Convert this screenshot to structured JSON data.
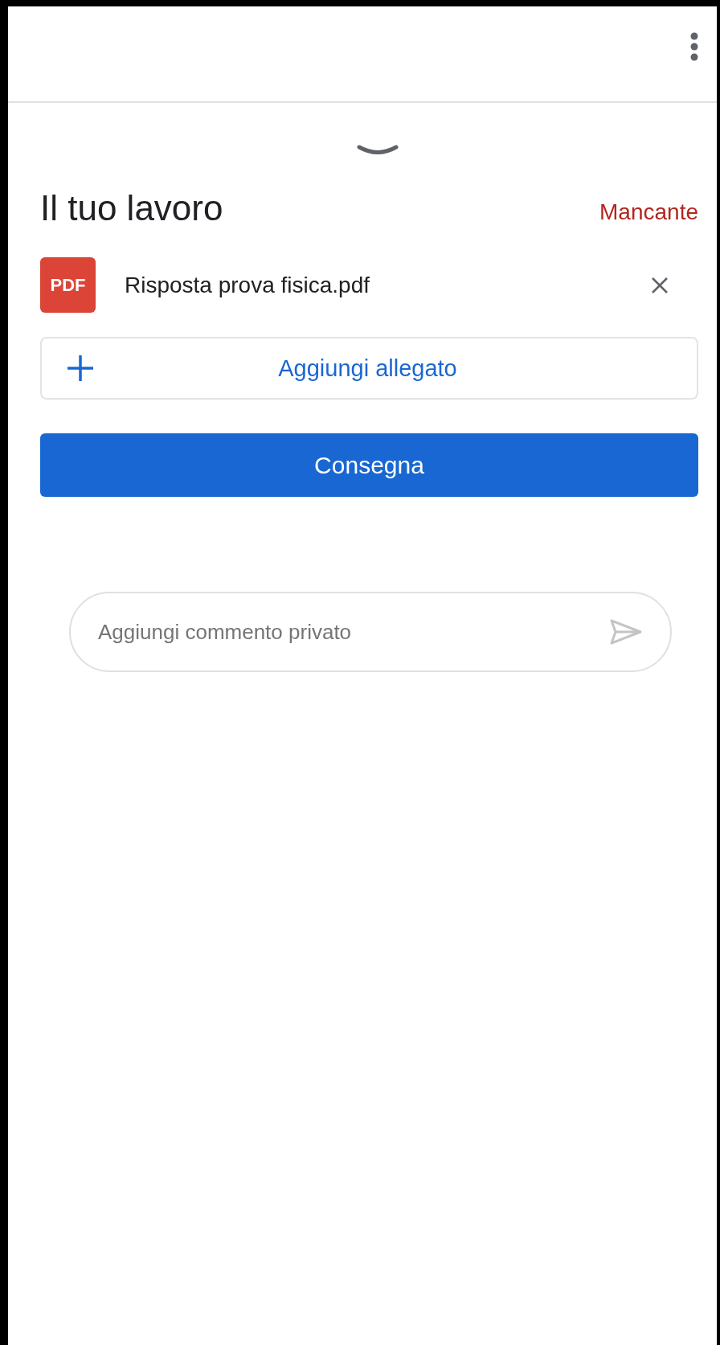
{
  "work": {
    "title": "Il tuo lavoro",
    "status": "Mancante",
    "attachments": [
      {
        "kind": "pdf",
        "badge": "PDF",
        "name": "Risposta prova fisica.pdf"
      }
    ],
    "add_button": "Aggiungi allegato",
    "submit_button": "Consegna"
  },
  "comment": {
    "placeholder": "Aggiungi commento privato"
  }
}
